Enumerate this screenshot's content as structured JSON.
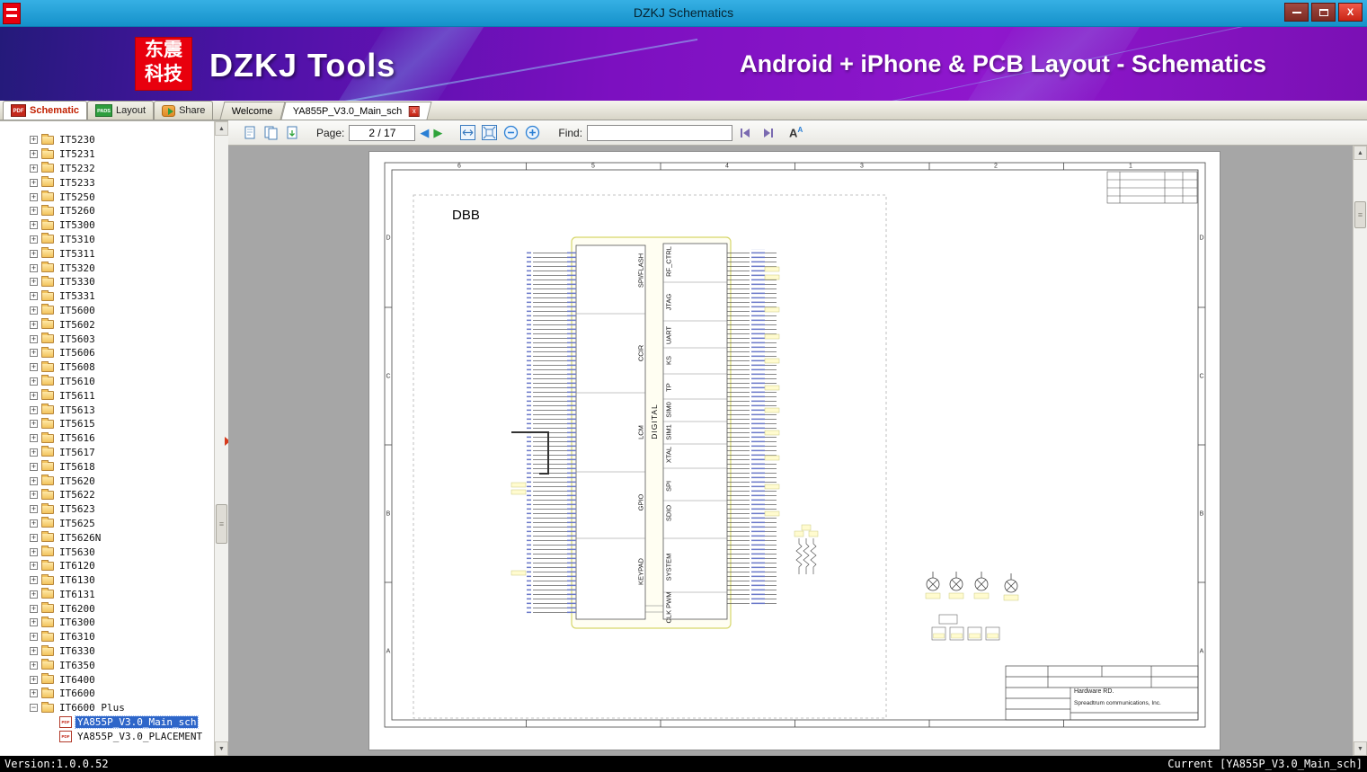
{
  "window": {
    "title": "DZKJ Schematics",
    "close_glyph": "X"
  },
  "banner": {
    "logo_top": "东震",
    "logo_bottom": "科技",
    "app_name": "DZKJ Tools",
    "tagline": "Android + iPhone & PCB Layout - Schematics"
  },
  "icons": {
    "pdf_text": "PDF",
    "pads_text": "PADS",
    "tab_close_glyph": "x"
  },
  "mode_tabs": [
    {
      "label": "Schematic"
    },
    {
      "label": "Layout"
    },
    {
      "label": "Share"
    }
  ],
  "doc_tabs": [
    {
      "label": "Welcome"
    },
    {
      "label": "YA855P_V3.0_Main_sch"
    }
  ],
  "toolbar": {
    "page_label": "Page:",
    "page_value": "2 / 17",
    "find_label": "Find:",
    "find_value": ""
  },
  "sidebar": {
    "expander_collapsed": "+",
    "expander_expanded": "−",
    "folders": [
      "IT5230",
      "IT5231",
      "IT5232",
      "IT5233",
      "IT5250",
      "IT5260",
      "IT5300",
      "IT5310",
      "IT5311",
      "IT5320",
      "IT5330",
      "IT5331",
      "IT5600",
      "IT5602",
      "IT5603",
      "IT5606",
      "IT5608",
      "IT5610",
      "IT5611",
      "IT5613",
      "IT5615",
      "IT5616",
      "IT5617",
      "IT5618",
      "IT5620",
      "IT5622",
      "IT5623",
      "IT5625",
      "IT5626N",
      "IT5630",
      "IT6120",
      "IT6130",
      "IT6131",
      "IT6200",
      "IT6300",
      "IT6310",
      "IT6330",
      "IT6350",
      "IT6400",
      "IT6600"
    ],
    "expanded_folder": "IT6600 Plus",
    "files": [
      {
        "label": "YA855P_V3.0_Main_sch",
        "selected": true
      },
      {
        "label": "YA855P_V3.0_PLACEMENT",
        "selected": false
      }
    ]
  },
  "schematic": {
    "page_title": "DBB",
    "grid_cols": [
      "6",
      "5",
      "4",
      "3",
      "2",
      "1"
    ],
    "grid_rows": [
      "D",
      "C",
      "B",
      "A"
    ],
    "left_sections": [
      "SPI/FLASH",
      "CCIR",
      "LCM",
      "GPIO",
      "KEYPAD"
    ],
    "center_section": "DIGITAL",
    "right_sections": [
      "RF_CTRL",
      "JTAG",
      "UART",
      "KS",
      "TP",
      "SIM0",
      "SIM1",
      "XTAL",
      "SPI",
      "SDIO",
      "SYSTEM",
      "CLK PWM"
    ],
    "title_block": {
      "department": "Hardware RD.",
      "company": "Spreadtrum communications, Inc."
    }
  },
  "status_bar": {
    "left": "Version:1.0.0.52",
    "right": "Current [YA855P_V3.0_Main_sch]"
  }
}
